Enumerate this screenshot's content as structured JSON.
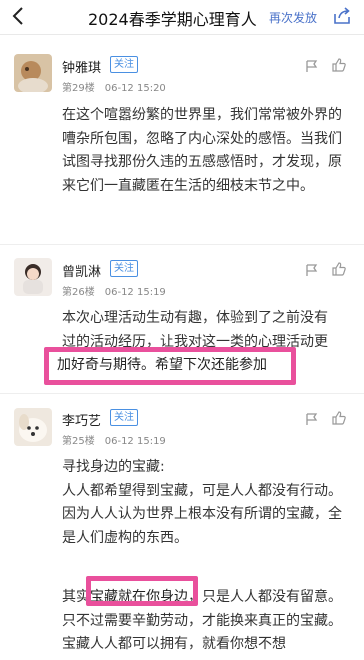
{
  "header": {
    "title": "2024春季学期心理育人",
    "resend": "再次发放"
  },
  "comments": [
    {
      "name": "钟雅琪",
      "follow": "关注",
      "floor": "第29楼",
      "date": "06-12 15:20",
      "text": "在这个喧嚣纷繁的世界里，我们常常被外界的嘈杂所包围，忽略了内心深处的感悟。当我们试图寻找那份久违的五感感悟时，才发现，原来它们一直藏匿在生活的细枝末节之中。"
    },
    {
      "name": "曾凯淋",
      "follow": "关注",
      "floor": "第26楼",
      "date": "06-12 15:19",
      "text_line1": "本次心理活动生动有趣，体验到了之前没有",
      "text_line2": "过的活动经历，让我对这一类的心理活动更",
      "highlight": "加好奇与期待。希望下次还能参加"
    },
    {
      "name": "李巧艺",
      "follow": "关注",
      "floor": "第25楼",
      "date": "06-12 15:19",
      "p1": "寻找身边的宝藏:",
      "p2": "人人都希望得到宝藏，可是人人都没有行动。因为人人认为世界上根本没有所谓的宝藏，全是人们虚构的东西。",
      "p3_prefix": "其实",
      "p3_highlight": "宝藏就在你身边",
      "p3_suffix": "，只是人人都没有留意。只不过需要辛勤劳动，才能换来真正的宝藏。宝藏人人都可以拥有，就看你想不想"
    }
  ],
  "icons": [
    "back-arrow-icon",
    "share-icon",
    "flag-icon",
    "thumbs-up-icon"
  ],
  "colors": {
    "accent": "#4a72c9",
    "highlight_border": "#e9509c",
    "follow": "#4a90e2"
  }
}
